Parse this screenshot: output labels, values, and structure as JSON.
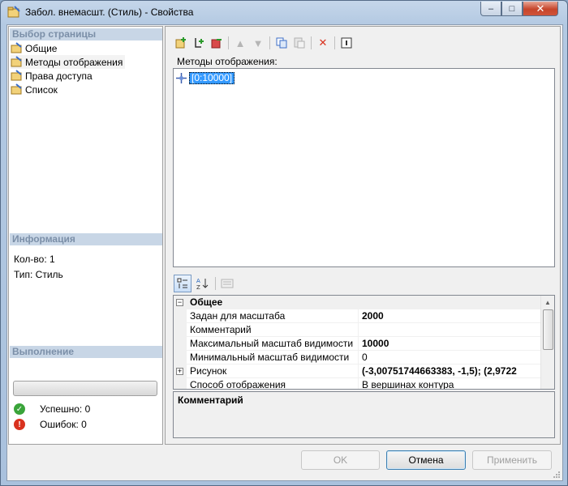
{
  "window": {
    "title": "Забол. внемасшт. (Стиль) - Свойства",
    "controls": {
      "minimize": "–",
      "maximize": "□",
      "close": "✕"
    }
  },
  "left": {
    "pages_header": "Выбор страницы",
    "pages": [
      "Общие",
      "Методы отображения",
      "Права доступа",
      "Список"
    ],
    "selected_page": "Методы отображения",
    "info_header": "Информация",
    "info": {
      "count": "Кол-во: 1",
      "type": "Тип: Стиль"
    },
    "exec_header": "Выполнение",
    "success": "Успешно: 0",
    "errors": "Ошибок: 0"
  },
  "right": {
    "toolbar_icons": [
      "add-icon",
      "add-child-icon",
      "remove-icon",
      "move-up-icon",
      "move-down-icon",
      "copy-icon",
      "paste-icon",
      "delete-icon",
      "properties-icon"
    ],
    "list_label": "Методы отображения:",
    "list_items": [
      "[0:10000]"
    ],
    "grid": {
      "category": "Общее",
      "rows": [
        {
          "name": "Задан для масштаба",
          "value": "2000",
          "bold": true
        },
        {
          "name": "Комментарий",
          "value": "",
          "bold": true
        },
        {
          "name": "Максимальный масштаб видимости",
          "value": "10000",
          "bold": true
        },
        {
          "name": "Минимальный масштаб видимости",
          "value": "0",
          "bold": false
        },
        {
          "name": "Рисунок",
          "value": "(-3,00751744663383, -1,5); (2,9722",
          "bold": true,
          "expandable": true
        },
        {
          "name": "Способ отображения",
          "value": "В  вершинах  контура",
          "bold": false
        }
      ]
    },
    "description_title": "Комментарий"
  },
  "buttons": {
    "ok": "OK",
    "cancel": "Отмена",
    "apply": "Применить"
  },
  "colors": {
    "selection": "#3399ff",
    "header_bg": "#c8d6e6",
    "header_text": "#7b8fa8",
    "success": "#3aa43a",
    "error": "#d9321f"
  }
}
